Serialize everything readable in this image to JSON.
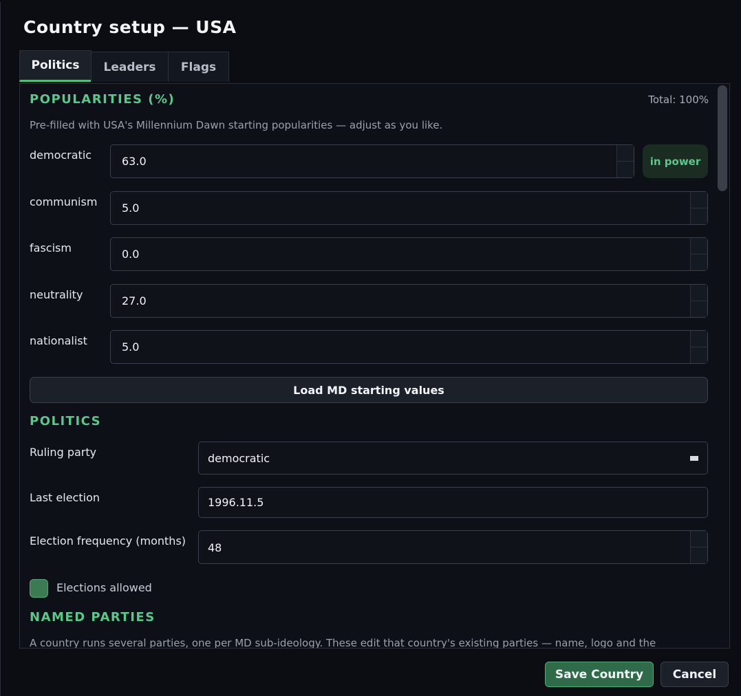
{
  "window": {
    "title": "Country setup — USA"
  },
  "tabs": [
    {
      "label": "Politics",
      "active": true
    },
    {
      "label": "Leaders",
      "active": false
    },
    {
      "label": "Flags",
      "active": false
    }
  ],
  "popularities": {
    "heading": "POPULARITIES (%)",
    "total": "Total: 100%",
    "hint": "Pre-filled with USA's Millennium Dawn starting popularities — adjust as you like.",
    "rows": [
      {
        "label": "democratic",
        "value": "63.0"
      },
      {
        "label": "communism",
        "value": "5.0"
      },
      {
        "label": "fascism",
        "value": "0.0"
      },
      {
        "label": "neutrality",
        "value": "27.0"
      },
      {
        "label": "nationalist",
        "value": "5.0"
      }
    ],
    "in_power_badge": "in power",
    "load_button": "Load MD starting values"
  },
  "politics": {
    "heading": "POLITICS",
    "ruling_party_label": "Ruling party",
    "ruling_party_value": "democratic",
    "last_election_label": "Last election",
    "last_election_value": "1996.11.5",
    "election_frequency_label": "Election frequency (months)",
    "election_frequency_value": "48",
    "elections_allowed_label": "Elections allowed",
    "elections_allowed_checked": true
  },
  "named_parties": {
    "heading": "NAMED PARTIES",
    "hint": "A country runs several parties, one per MD sub-ideology. These edit that country's existing parties — name, logo and the"
  },
  "footer": {
    "save_label": "Save Country",
    "cancel_label": "Cancel"
  },
  "colors": {
    "accent": "#58c98a",
    "background": "#0b0d12",
    "save_button": "#2f6b48"
  }
}
